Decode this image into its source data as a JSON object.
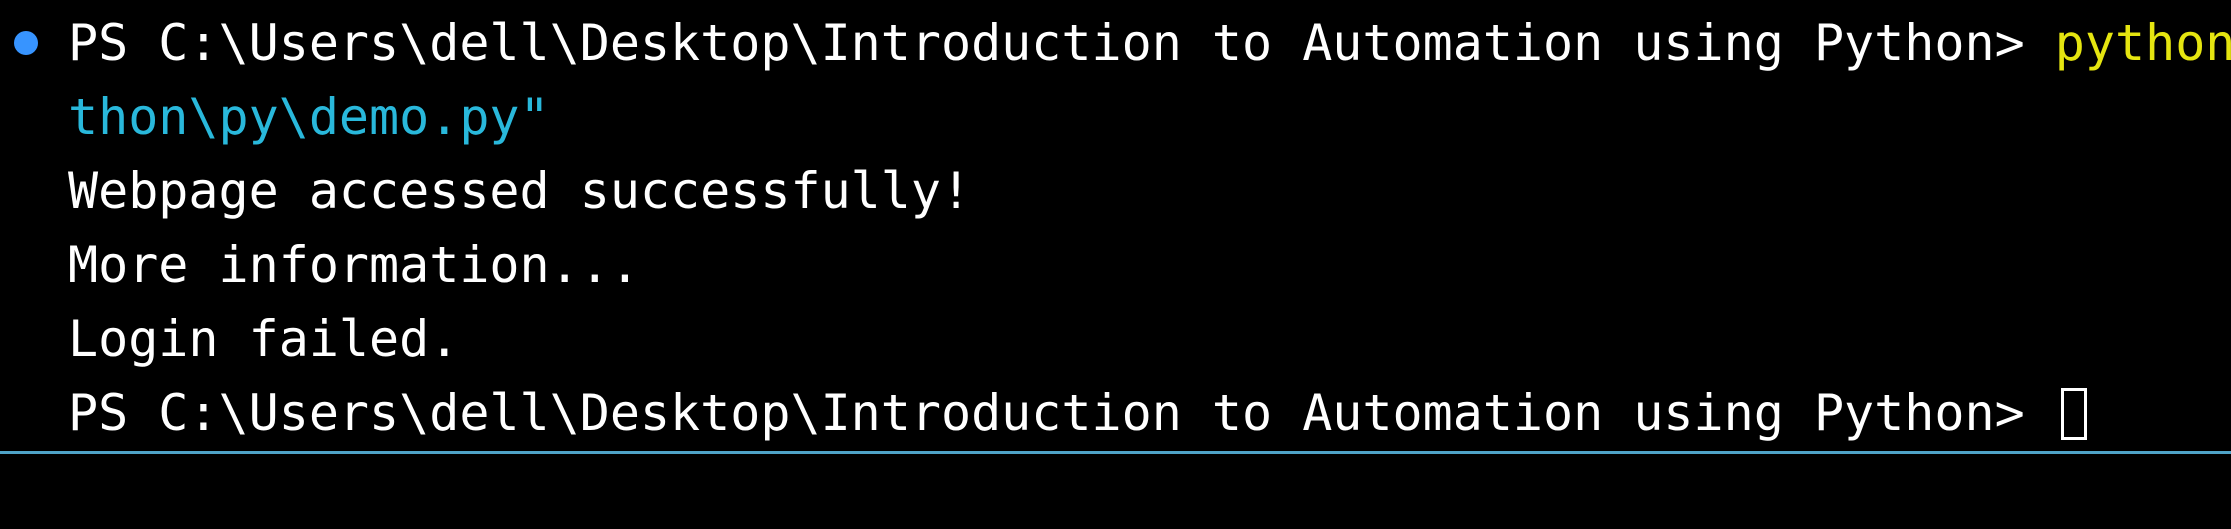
{
  "terminal": {
    "lines": [
      {
        "prompt": "PS C:\\Users\\dell\\Desktop\\Introduction to Automation using Python> ",
        "command": "python"
      },
      {
        "continuation": "thon\\py\\demo.py\""
      },
      {
        "output": "Webpage accessed successfully!"
      },
      {
        "output": "More information..."
      },
      {
        "output": "Login failed."
      },
      {
        "prompt": "PS C:\\Users\\dell\\Desktop\\Introduction to Automation using Python> "
      }
    ]
  },
  "colors": {
    "background": "#000000",
    "text": "#ffffff",
    "command": "#e5e510",
    "argument": "#29b8db",
    "status_dot": "#3794ff",
    "divider": "#4fa3c7"
  },
  "icons": {
    "status_dot": "command-status-dot-icon",
    "cursor": "text-cursor-icon"
  }
}
